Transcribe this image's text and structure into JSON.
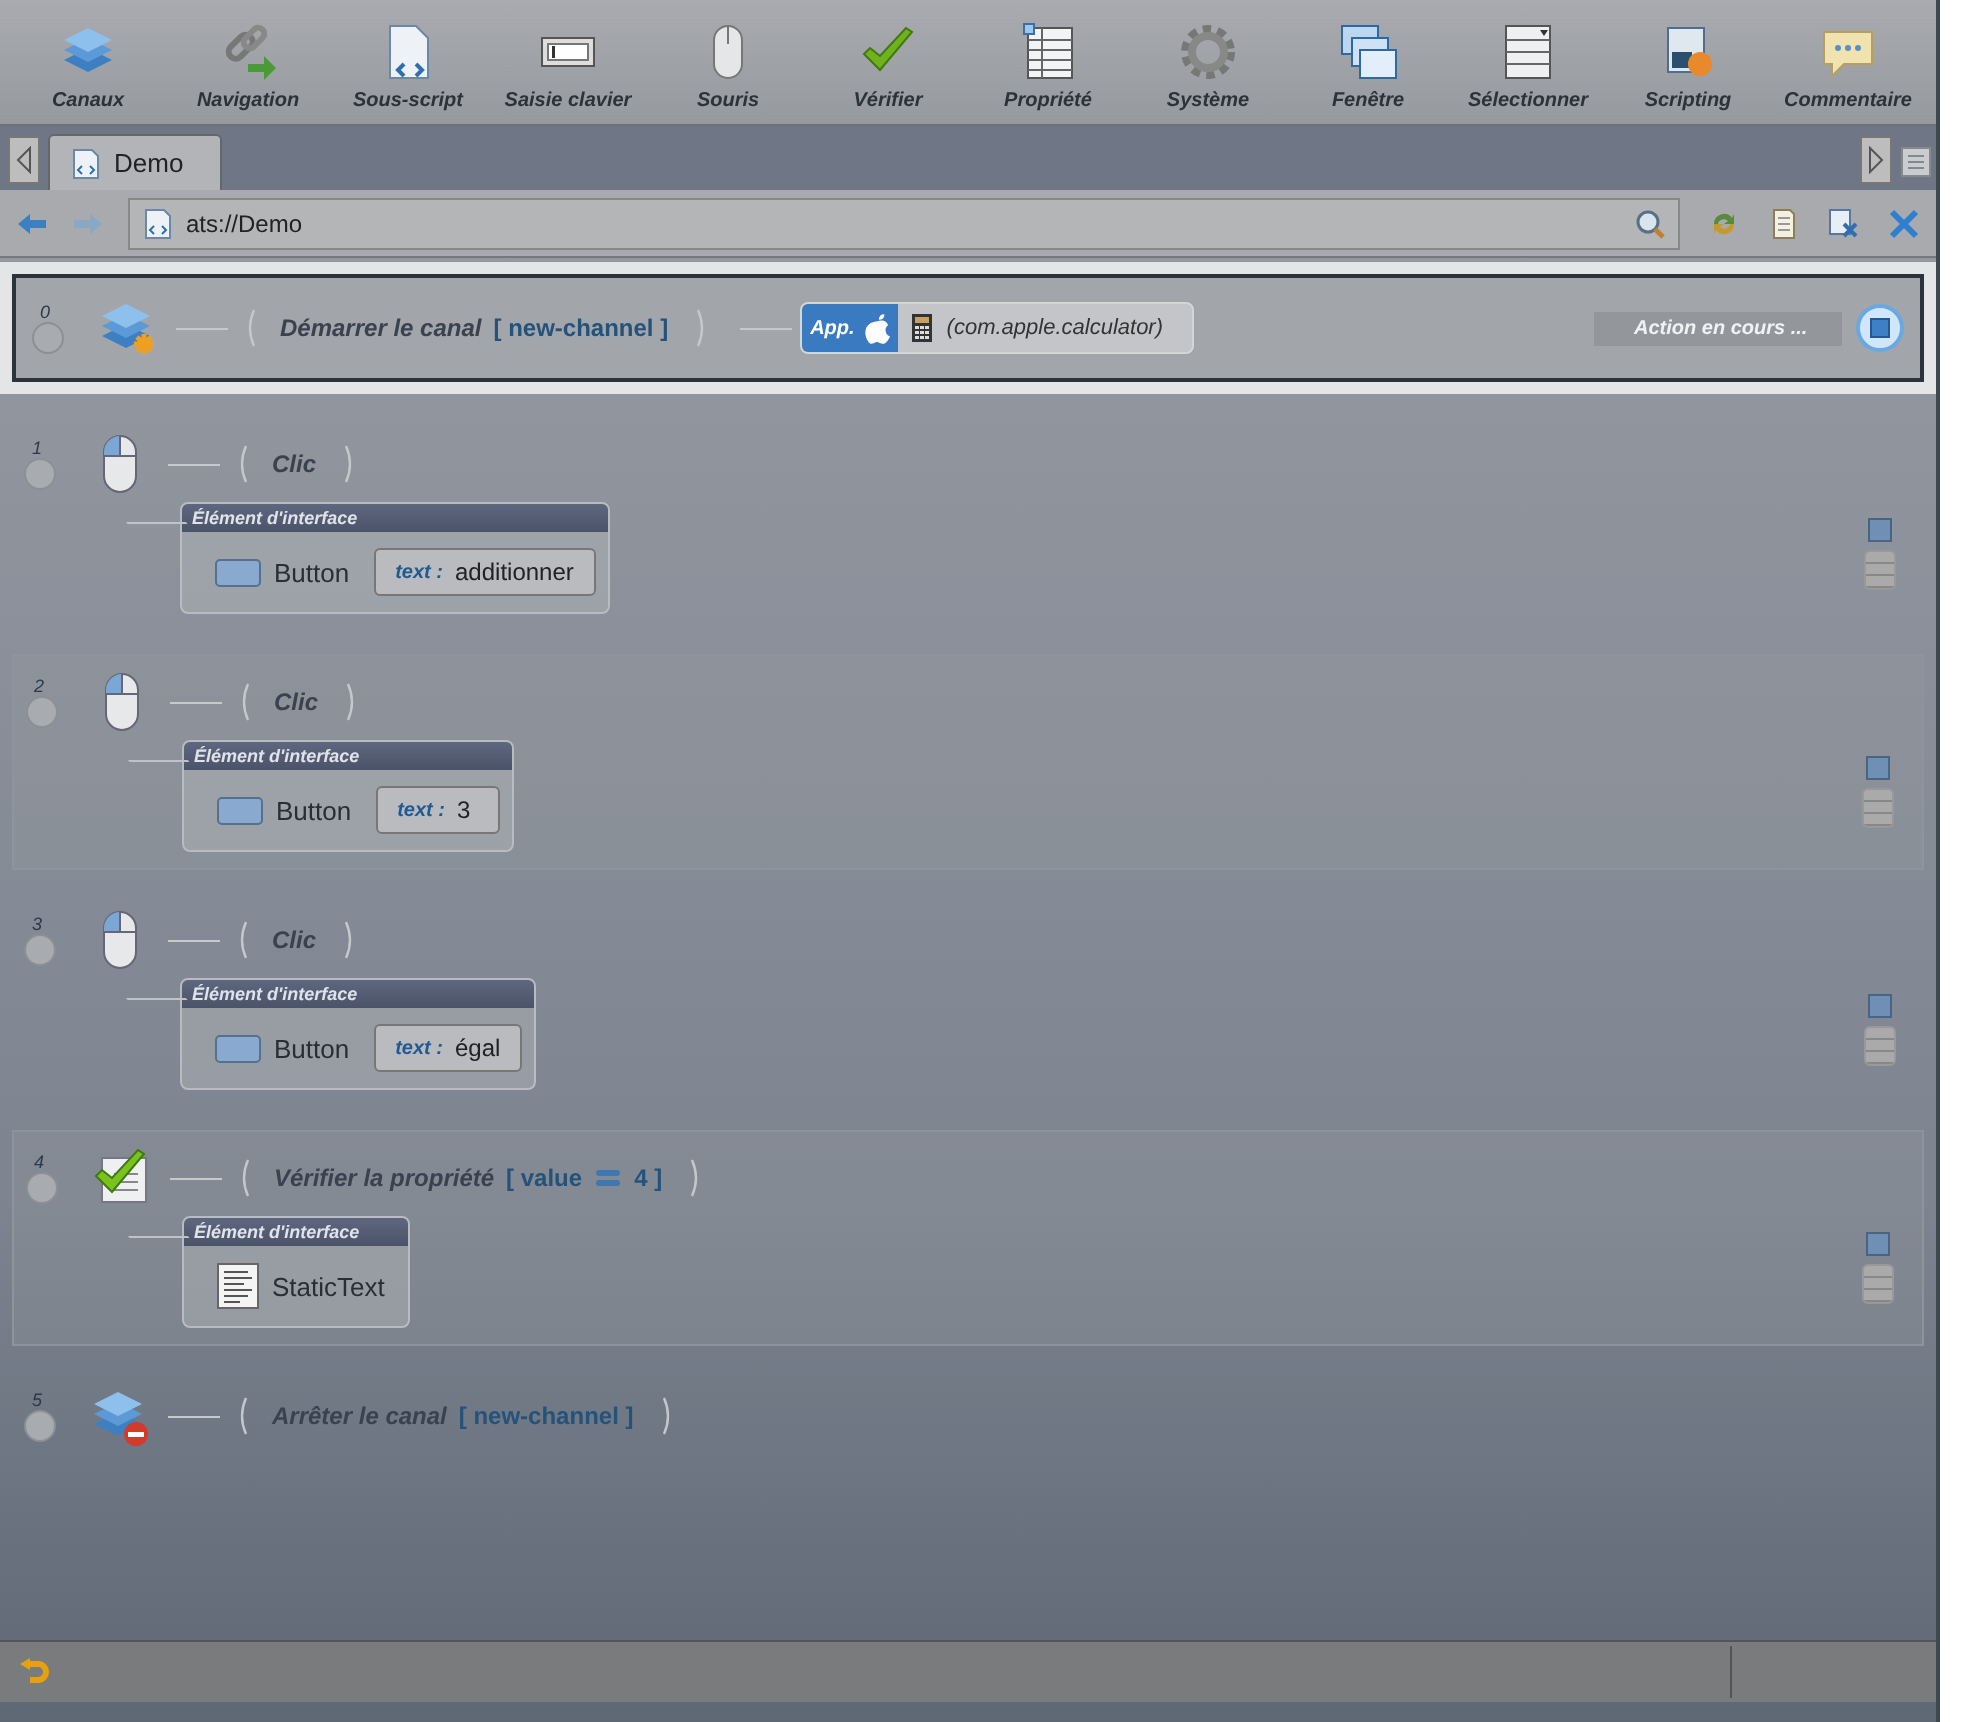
{
  "toolbar": [
    {
      "label": "Canaux"
    },
    {
      "label": "Navigation"
    },
    {
      "label": "Sous-script"
    },
    {
      "label": "Saisie clavier"
    },
    {
      "label": "Souris"
    },
    {
      "label": "Vérifier"
    },
    {
      "label": "Propriété"
    },
    {
      "label": "Système"
    },
    {
      "label": "Fenêtre"
    },
    {
      "label": "Sélectionner"
    },
    {
      "label": "Scripting"
    },
    {
      "label": "Commentaire"
    }
  ],
  "tabs": [
    {
      "label": "Demo",
      "selected": true
    }
  ],
  "address": {
    "value": "ats://Demo"
  },
  "actions": [
    {
      "number": "0",
      "kind": "channel-start",
      "title": "Démarrer le canal",
      "param": "[ new-channel ]",
      "app": {
        "badge": "App.",
        "target": "(com.apple.calculator)"
      },
      "status": "Action en cours ...",
      "selected": true
    },
    {
      "number": "1",
      "kind": "click",
      "title": "Clic",
      "selected": false,
      "element": {
        "header": "Élément d'interface",
        "type": "Button",
        "kind": "button",
        "attr": "text :",
        "value": "additionner"
      }
    },
    {
      "number": "2",
      "kind": "click",
      "title": "Clic",
      "selected": false,
      "element": {
        "header": "Élément d'interface",
        "type": "Button",
        "kind": "button",
        "attr": "text :",
        "value": "3"
      }
    },
    {
      "number": "3",
      "kind": "click",
      "title": "Clic",
      "selected": false,
      "element": {
        "header": "Élément d'interface",
        "type": "Button",
        "kind": "button",
        "attr": "text :",
        "value": "égal"
      }
    },
    {
      "number": "4",
      "kind": "check",
      "title": "Vérifier la propriété",
      "param": "[ value",
      "param_value": "4 ]",
      "selected": false,
      "element": {
        "header": "Élément d'interface",
        "type": "StaticText",
        "kind": "static-text"
      }
    },
    {
      "number": "5",
      "kind": "channel-stop",
      "title": "Arrêter le canal",
      "param": "[ new-channel ]",
      "selected": false
    }
  ]
}
